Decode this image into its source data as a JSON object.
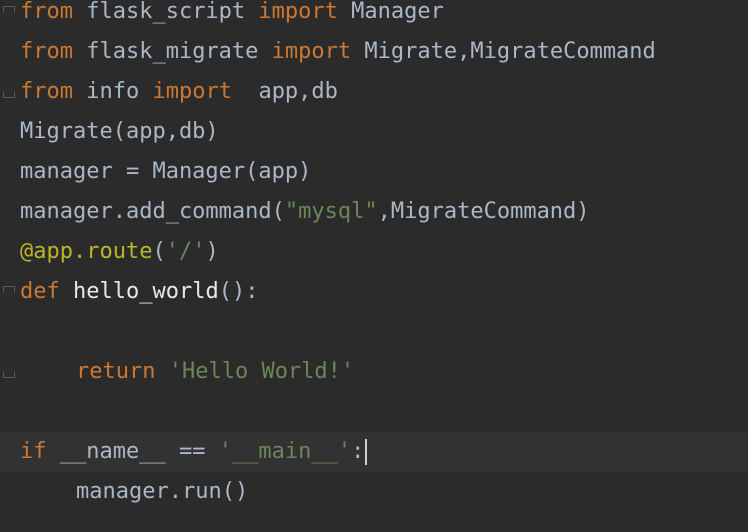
{
  "editor": {
    "lines": [
      {
        "k1": "from",
        "t1": " flask_script ",
        "k2": "import",
        "t2": " Manager"
      },
      {
        "k1": "from",
        "t1": " flask_migrate ",
        "k2": "import",
        "t2": " Migrate,MigrateCommand"
      },
      {
        "k1": "from",
        "t1": " info ",
        "k2": "import",
        "t2": "  app,db"
      },
      {
        "t1": "Migrate(app,db)"
      },
      {
        "t1": "manager = Manager(app)"
      },
      {
        "t1": "manager.add_command(",
        "s1": "\"mysql\"",
        "t2": ",MigrateCommand)"
      },
      {
        "d1": "@app.route",
        "t1": "(",
        "s1": "'/'",
        "t2": ")"
      },
      {
        "k1": "def",
        "n1": " hello_world",
        "t1": "():"
      },
      {
        "t1": ""
      },
      {
        "k1": "return",
        "s1": " 'Hello World!'"
      },
      {
        "t1": ""
      },
      {
        "k1": "if",
        "t1": " __name__ == ",
        "s1": "'__main__'",
        "t2": ":"
      },
      {
        "t1": "manager.run()"
      }
    ]
  },
  "colors": {
    "background": "#2b2b2b",
    "keyword": "#cc7832",
    "plain": "#a9b7c6",
    "string": "#6a8759",
    "decorator": "#bbb529"
  }
}
